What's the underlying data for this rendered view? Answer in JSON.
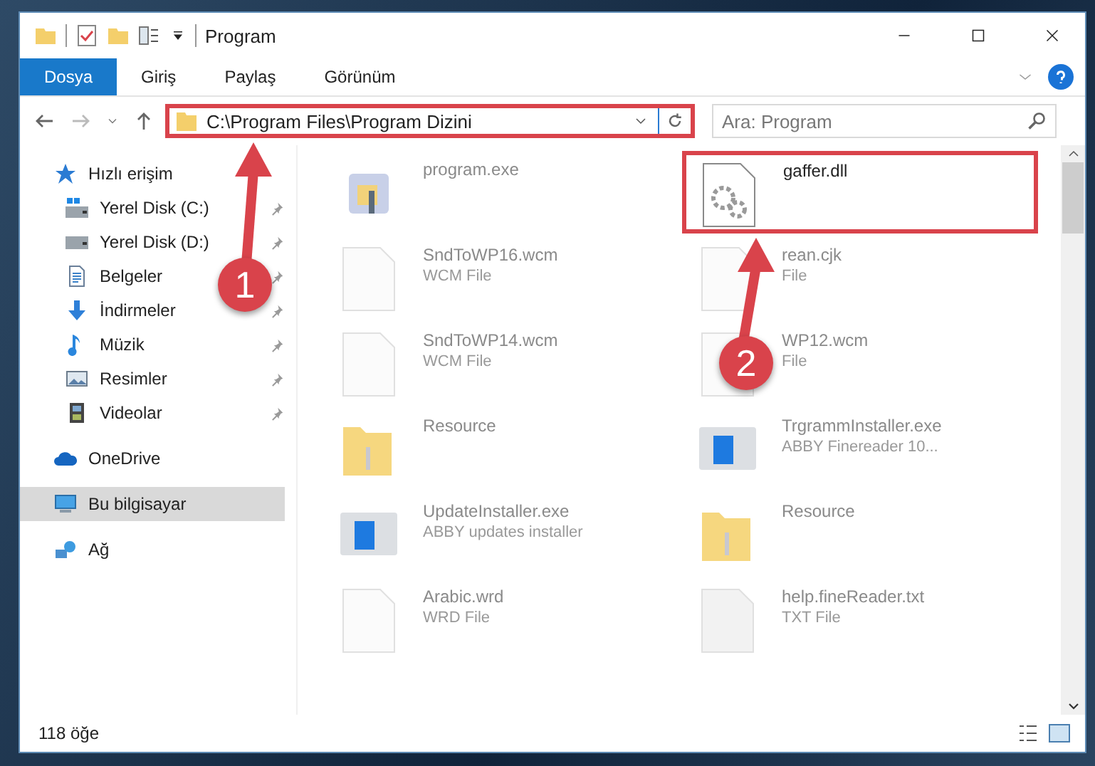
{
  "window": {
    "title": "Program"
  },
  "ribbon_tabs": [
    {
      "label": "Dosya",
      "selected": true
    },
    {
      "label": "Giriş",
      "selected": false
    },
    {
      "label": "Paylaş",
      "selected": false
    },
    {
      "label": "Görünüm",
      "selected": false
    }
  ],
  "address": {
    "path": "C:\\Program Files\\Program Dizini",
    "highlighted": true
  },
  "search": {
    "placeholder": "Ara: Program"
  },
  "sidebar": {
    "items": [
      {
        "label": "Hızlı erişim",
        "kind": "star",
        "selected": false,
        "children": [
          {
            "label": "Yerel Disk (C:)",
            "kind": "drive-win",
            "pinned": true,
            "selected": false
          },
          {
            "label": "Yerel Disk (D:)",
            "kind": "drive",
            "pinned": true,
            "selected": false
          },
          {
            "label": "Belgeler",
            "kind": "docs",
            "pinned": true,
            "selected": false
          },
          {
            "label": "İndirmeler",
            "kind": "download",
            "pinned": true,
            "selected": false
          },
          {
            "label": "Müzik",
            "kind": "music",
            "pinned": true,
            "selected": false
          },
          {
            "label": "Resimler",
            "kind": "pictures",
            "pinned": true,
            "selected": false
          },
          {
            "label": "Videolar",
            "kind": "videos",
            "pinned": true,
            "selected": false
          }
        ]
      },
      {
        "label": "OneDrive",
        "kind": "cloud",
        "selected": false
      },
      {
        "label": "Bu bilgisayar",
        "kind": "pc",
        "selected": true
      },
      {
        "label": "Ağ",
        "kind": "network",
        "selected": false
      }
    ]
  },
  "files": [
    {
      "name": "program.exe",
      "kind": "app",
      "highlighted": false
    },
    {
      "name": "gaffer.dll",
      "kind": "dll",
      "highlighted": true
    },
    {
      "name": "SndToWP16.wcm",
      "type": "WCM File",
      "kind": "doc",
      "highlighted": false
    },
    {
      "name": "rean.cjk",
      "type": "File",
      "kind": "doc",
      "highlighted": false
    },
    {
      "name": "SndToWP14.wcm",
      "type": "WCM File",
      "kind": "doc",
      "highlighted": false
    },
    {
      "name": "WP12.wcm",
      "type": "File",
      "kind": "doc",
      "highlighted": false
    },
    {
      "name": "Resource",
      "kind": "folder",
      "highlighted": false
    },
    {
      "name": "TrgrammInstaller.exe",
      "type": "ABBY Finereader 10...",
      "kind": "installer",
      "highlighted": false
    },
    {
      "name": "UpdateInstaller.exe",
      "type": "ABBY updates installer",
      "kind": "installer",
      "highlighted": false
    },
    {
      "name": "Resource",
      "kind": "folder",
      "highlighted": false
    },
    {
      "name": "Arabic.wrd",
      "type": "WRD File",
      "kind": "doc",
      "highlighted": false
    },
    {
      "name": "help.fineReader.txt",
      "type": "TXT File",
      "kind": "text",
      "highlighted": false
    }
  ],
  "annotations": [
    {
      "label": "1"
    },
    {
      "label": "2"
    }
  ],
  "status_bar": {
    "count": "118 öğe"
  }
}
